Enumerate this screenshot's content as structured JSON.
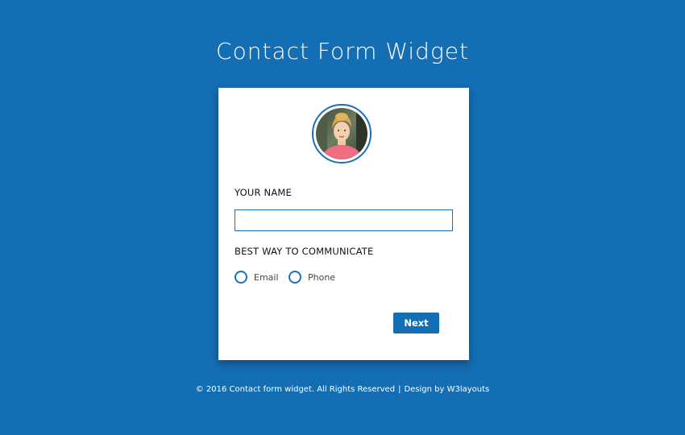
{
  "page": {
    "title": "Contact Form Widget",
    "background_color": "#146eb4"
  },
  "form": {
    "avatar": "woman-portrait-avatar",
    "name_label": "YOUR NAME",
    "name_value": "",
    "communicate_label": "BEST WAY TO COMMUNICATE",
    "options": [
      {
        "label": "Email",
        "selected": false
      },
      {
        "label": "Phone",
        "selected": false
      }
    ],
    "next_label": "Next",
    "accent_color": "#1a70b8"
  },
  "footer": {
    "copyright": "© 2016 Contact form widget. All Rights Reserved",
    "separator": "|",
    "design_credit": "Design by W3layouts"
  }
}
